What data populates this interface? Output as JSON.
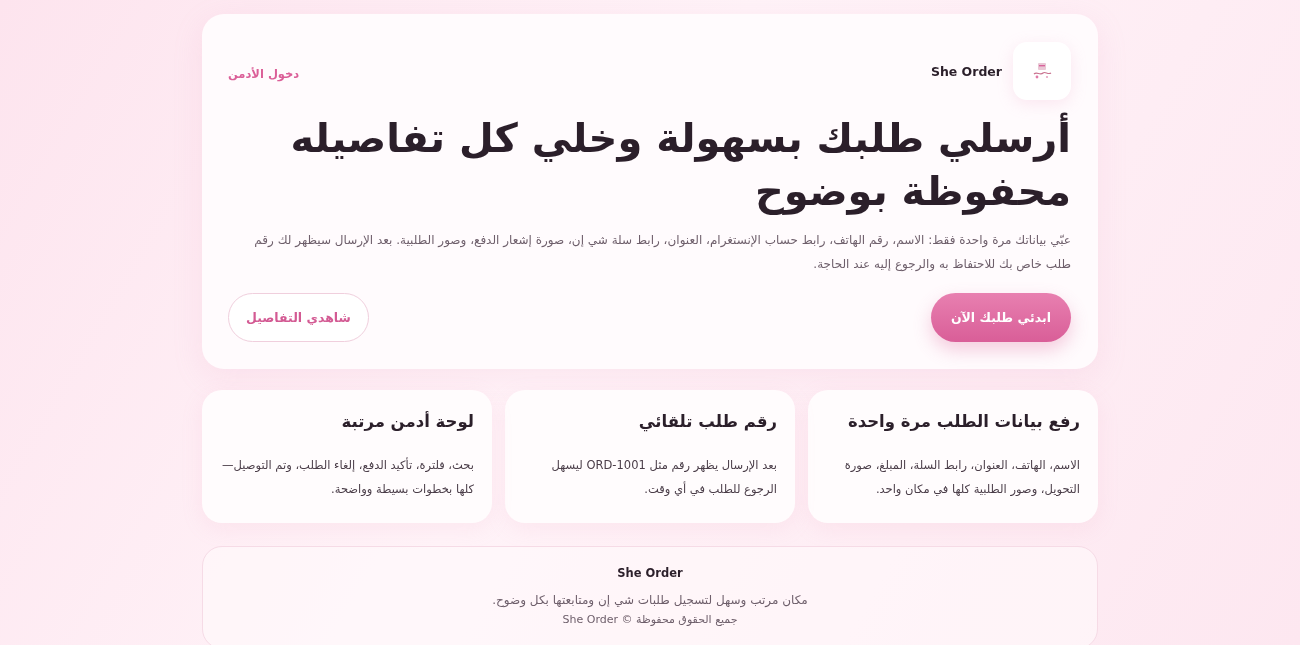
{
  "header": {
    "brand": "She Order",
    "admin_link": "دخول الأدمن"
  },
  "hero": {
    "title": "أرسلي طلبك بسهولة وخلي كل تفاصيله محفوظة بوضوح",
    "description": "عبّي بياناتك مرة واحدة فقط: الاسم، رقم الهاتف، رابط حساب الإنستغرام، العنوان، رابط سلة شي إن، صورة إشعار الدفع، وصور الطلبية. بعد الإرسال سيظهر لك رقم طلب خاص بك للاحتفاظ به والرجوع إليه عند الحاجة.",
    "buttons": [
      {
        "label": "ابدئي طلبك الآن",
        "kind": "primary"
      },
      {
        "label": "شاهدي التفاصيل",
        "kind": "secondary"
      }
    ]
  },
  "features": [
    {
      "title": "رفع بيانات الطلب مرة واحدة",
      "text": "الاسم، الهاتف، العنوان، رابط السلة، المبلغ، صورة التحويل، وصور الطلبية كلها في مكان واحد."
    },
    {
      "title": "رقم طلب تلقائي",
      "text": "بعد الإرسال يظهر رقم مثل ORD-1001 ليسهل الرجوع للطلب في أي وقت."
    },
    {
      "title": "لوحة أدمن مرتبة",
      "text": "بحث، فلترة، تأكيد الدفع، إلغاء الطلب، وتم التوصيل—كلها بخطوات بسيطة وواضحة."
    }
  ],
  "footer": {
    "brand": "She Order",
    "tagline": "مكان مرتب وسهل لتسجيل طلبات شي إن ومتابعتها بكل وضوح.",
    "copyright": "جميع الحقوق محفوظة © She Order"
  }
}
